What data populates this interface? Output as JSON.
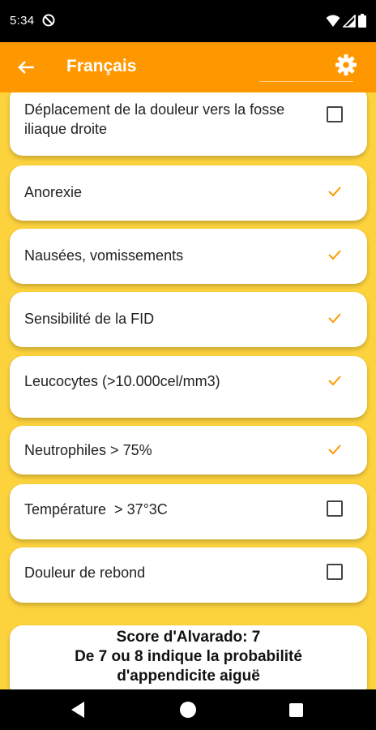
{
  "status_bar": {
    "time": "5:34"
  },
  "app_bar": {
    "title": "Français"
  },
  "items": [
    {
      "label": "Déplacement de la douleur vers la fosse iliaque droite",
      "checked": false
    },
    {
      "label": "Anorexie",
      "checked": true
    },
    {
      "label": "Nausées, vomissements",
      "checked": true
    },
    {
      "label": "Sensibilité de la FID",
      "checked": true
    },
    {
      "label": "Leucocytes (>10.000cel/mm3)",
      "checked": true
    },
    {
      "label": "Neutrophiles > 75%",
      "checked": true
    },
    {
      "label": "Température  > 37°3C",
      "checked": false
    },
    {
      "label": "Douleur de rebond",
      "checked": false
    }
  ],
  "score": {
    "line1": "Score d'Alvarado: 7",
    "line2": "De 7 ou 8 indique la probabilité",
    "line3": "d'appendicite aiguë"
  },
  "colors": {
    "app_bar": "#FF9800",
    "background": "#FDD33D",
    "check": "#FF9800"
  }
}
